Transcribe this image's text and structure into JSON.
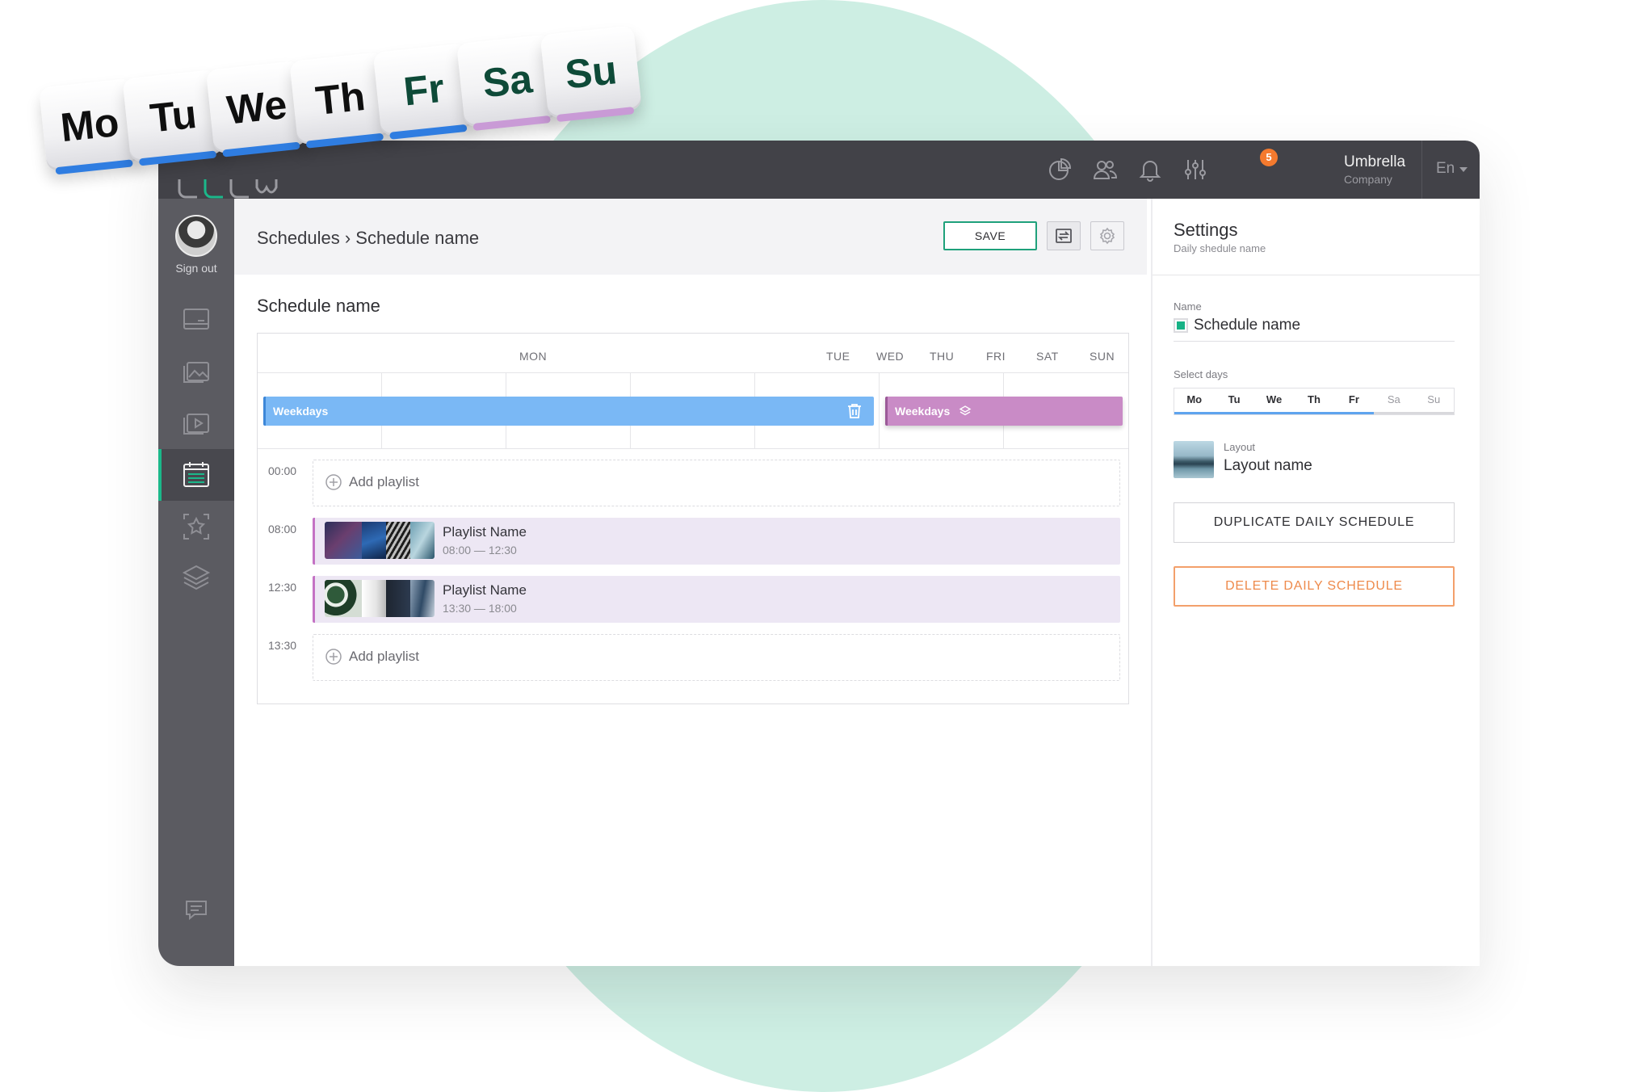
{
  "topbar": {
    "notifications_count": "5",
    "company_name": "Umbrella",
    "company_sub": "Company",
    "language": "En",
    "icons": [
      "analytics-icon",
      "users-icon",
      "bell-icon",
      "sliders-icon"
    ]
  },
  "sidebar": {
    "sign_out": "Sign out",
    "items": [
      "devices-icon",
      "media-icon",
      "playlists-icon",
      "schedules-icon",
      "favorites-icon",
      "layers-icon"
    ],
    "bottom_icon": "chat-icon"
  },
  "header": {
    "breadcrumb": "Schedules › Schedule name",
    "save_label": "SAVE"
  },
  "schedule": {
    "title": "Schedule name",
    "days": [
      "MON",
      "TUE",
      "WED",
      "THU",
      "FRI",
      "SAT",
      "SUN"
    ],
    "bars": [
      {
        "label": "Weekdays",
        "color": "#7ab8f5"
      },
      {
        "label": "Weekdays",
        "color": "#c98bc6"
      }
    ],
    "slots": [
      {
        "time": "00:00",
        "add_label": "Add playlist"
      },
      {
        "time": "08:00",
        "name": "Playlist Name",
        "range": "08:00 — 12:30"
      },
      {
        "time": "12:30",
        "name": "Playlist Name",
        "range": "13:30 — 18:00"
      },
      {
        "time": "13:30",
        "add_label": "Add playlist"
      }
    ]
  },
  "settings": {
    "title": "Settings",
    "subtitle": "Daily shedule name",
    "name_label": "Name",
    "name_value": "Schedule name",
    "name_color": "#17b286",
    "days_label": "Select days",
    "days": [
      {
        "label": "Mo",
        "on": true
      },
      {
        "label": "Tu",
        "on": true
      },
      {
        "label": "We",
        "on": true
      },
      {
        "label": "Th",
        "on": true
      },
      {
        "label": "Fr",
        "on": true
      },
      {
        "label": "Sa",
        "on": false
      },
      {
        "label": "Su",
        "on": false
      }
    ],
    "layout_label": "Layout",
    "layout_name": "Layout name",
    "duplicate_label": "DUPLICATE DAILY SCHEDULE",
    "delete_label": "DELETE DAILY SCHEDULE"
  },
  "keys": [
    {
      "label": "Mo",
      "color": "#0f0f0f",
      "stripe": "#2f7de1"
    },
    {
      "label": "Tu",
      "color": "#0f0f0f",
      "stripe": "#2f7de1"
    },
    {
      "label": "We",
      "color": "#0f0f0f",
      "stripe": "#2f7de1"
    },
    {
      "label": "Th",
      "color": "#0f0f0f",
      "stripe": "#2f7de1"
    },
    {
      "label": "Fr",
      "color": "#0e4a38",
      "stripe": "#2f7de1"
    },
    {
      "label": "Sa",
      "color": "#0e4a38",
      "stripe": "#c99ad6"
    },
    {
      "label": "Su",
      "color": "#0e4a38",
      "stripe": "#c99ad6"
    }
  ]
}
